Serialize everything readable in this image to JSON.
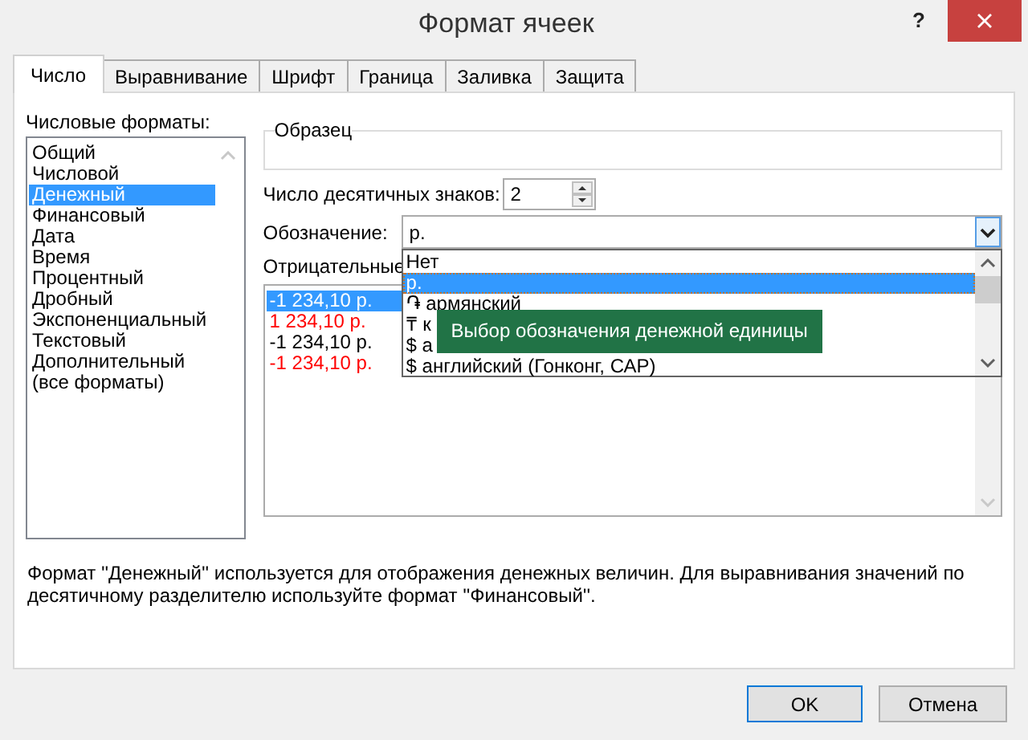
{
  "window": {
    "title": "Формат ячеек",
    "help": "?"
  },
  "tabs": [
    {
      "label": "Число",
      "selected": true
    },
    {
      "label": "Выравнивание",
      "selected": false
    },
    {
      "label": "Шрифт",
      "selected": false
    },
    {
      "label": "Граница",
      "selected": false
    },
    {
      "label": "Заливка",
      "selected": false
    },
    {
      "label": "Защита",
      "selected": false
    }
  ],
  "category": {
    "label": "Числовые форматы:",
    "items": [
      {
        "label": "Общий",
        "selected": false
      },
      {
        "label": "Числовой",
        "selected": false
      },
      {
        "label": "Денежный",
        "selected": true
      },
      {
        "label": "Финансовый",
        "selected": false
      },
      {
        "label": "Дата",
        "selected": false
      },
      {
        "label": "Время",
        "selected": false
      },
      {
        "label": "Процентный",
        "selected": false
      },
      {
        "label": "Дробный",
        "selected": false
      },
      {
        "label": "Экспоненциальный",
        "selected": false
      },
      {
        "label": "Текстовый",
        "selected": false
      },
      {
        "label": "Дополнительный",
        "selected": false
      },
      {
        "label": "(все форматы)",
        "selected": false
      }
    ]
  },
  "sample": {
    "label": "Образец"
  },
  "decimals": {
    "label": "Число десятичных знаков:",
    "value": "2"
  },
  "symbol": {
    "label": "Обозначение:",
    "value": "р.",
    "expanded": true,
    "options": [
      {
        "label": "Нет",
        "selected": false
      },
      {
        "label": "р.",
        "selected": true
      },
      {
        "label": "֏ армянский",
        "selected": false
      },
      {
        "label": "₸ к",
        "selected": false
      },
      {
        "label": "$ а",
        "selected": false
      },
      {
        "label": "$ английский (Гонконг, САР)",
        "selected": false
      }
    ]
  },
  "negatives": {
    "label": "Отрицательные",
    "items": [
      {
        "label": "-1 234,10 р.",
        "selected": true
      },
      {
        "label": "1 234,10 р.",
        "selected": false,
        "color": "#ff0000"
      },
      {
        "label": "-1 234,10 р.",
        "selected": false,
        "color": "#000000"
      },
      {
        "label": "-1 234,10 р.",
        "selected": false,
        "color": "#ff0000"
      }
    ]
  },
  "tooltip": "Выбор обозначения денежной единицы",
  "description": "Формат ''Денежный'' используется для отображения денежных величин. Для выравнивания значений по десятичному разделителю используйте формат ''Финансовый''.",
  "buttons": [
    {
      "label": "OK",
      "default": true
    },
    {
      "label": "Отмена",
      "default": false
    }
  ]
}
